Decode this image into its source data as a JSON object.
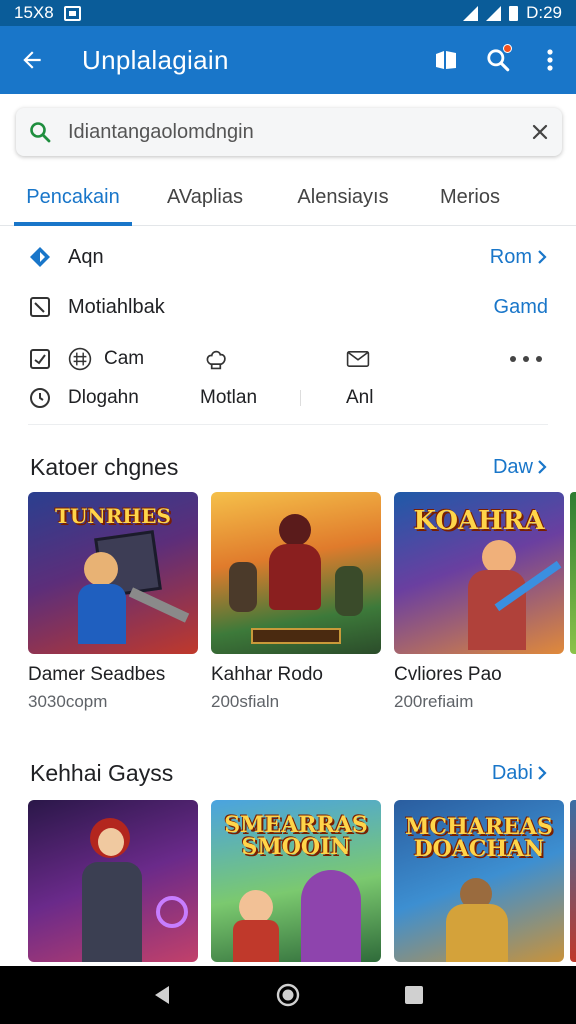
{
  "status_bar": {
    "time_left": "15X8",
    "time_right": "D:29"
  },
  "app_bar": {
    "title": "Unplalagiain"
  },
  "search": {
    "placeholder": "Idiantangaolomdngin"
  },
  "tabs": [
    {
      "label": "Pencakain",
      "active": true
    },
    {
      "label": "AVaplias",
      "active": false
    },
    {
      "label": "Alensiayıs",
      "active": false
    },
    {
      "label": "Merios",
      "active": false
    }
  ],
  "quick": {
    "row1": {
      "label": "Aqn",
      "link": "Rom"
    },
    "row2": {
      "label": "Motiahlbak",
      "link": "Gamd"
    },
    "row3": {
      "item1": "Cam"
    },
    "row4": {
      "item1": "Dlogahn",
      "item2": "Motlan",
      "item3": "Anl"
    }
  },
  "sections": [
    {
      "title": "Katoer chgnes",
      "more": "Daw",
      "cards": [
        {
          "name": "Damer Seadbes",
          "meta": "3030copm",
          "banner": "TUNRHES"
        },
        {
          "name": "Kahhar Rodo",
          "meta": "200sfialn",
          "banner": ""
        },
        {
          "name": "Cvliores Pao",
          "meta": "200refiaim",
          "banner": "KOAHRA"
        }
      ]
    },
    {
      "title": "Kehhai Gayss",
      "more": "Dabi",
      "cards": [
        {
          "name": "",
          "meta": "",
          "banner": ""
        },
        {
          "name": "",
          "meta": "",
          "banner": "SMEARRAS SMOOIN"
        },
        {
          "name": "",
          "meta": "",
          "banner": "MCHAREAS DOACHAN"
        }
      ]
    }
  ],
  "colors": {
    "accent": "#1976c9",
    "status_bar": "#0a5c99",
    "app_bar": "#1976c9"
  }
}
